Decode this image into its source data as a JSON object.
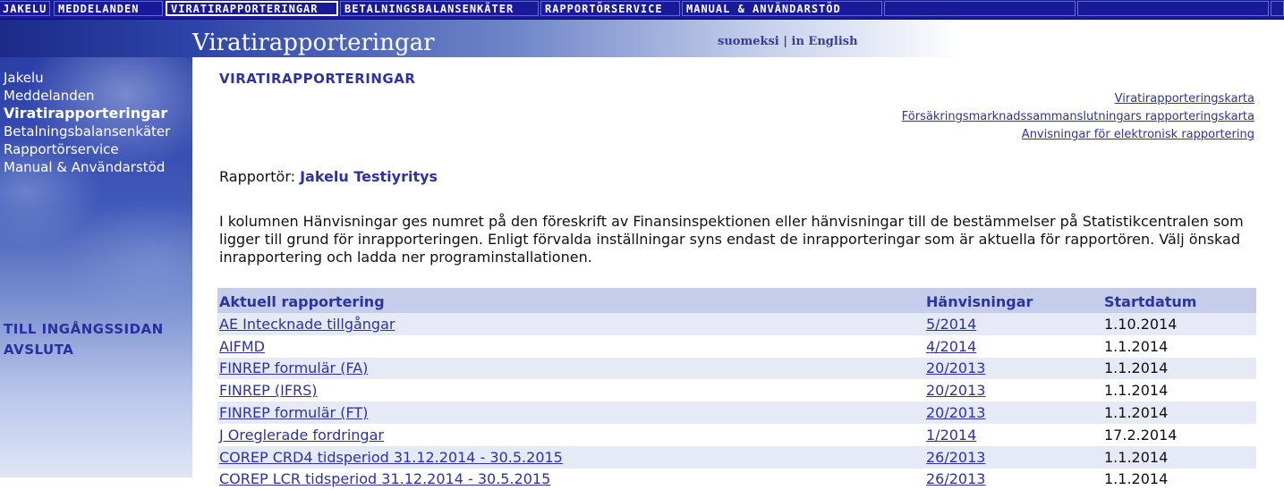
{
  "topnav": {
    "items": [
      "JAKELU",
      "MEDDELANDEN",
      "VIRATIRAPPORTERINGAR",
      "BETALNINGSBALANSENKÄTER",
      "RAPPORTÖRSERVICE",
      "MANUAL & ANVÄNDARSTÖD"
    ]
  },
  "header": {
    "title": "Viratirapporteringar",
    "lang_fi": "suomeksi",
    "lang_sep": " | ",
    "lang_en": "in English"
  },
  "sidebar": {
    "items": [
      "Jakelu",
      "Meddelanden",
      "Viratirapporteringar",
      "Betalningsbalansenkäter",
      "Rapportörservice",
      "Manual & Användarstöd"
    ],
    "bottom": [
      "TILL INGÅNGSSIDAN",
      "AVSLUTA"
    ]
  },
  "main": {
    "title": "VIRATIRAPPORTERINGAR",
    "links": [
      "Viratirapporteringskarta",
      "Försäkringsmarknadssammanslutningars rapporteringskarta",
      "Anvisningar för elektronisk rapportering"
    ],
    "reporter_label": "Rapportör:",
    "reporter_name": "Jakelu Testiyritys",
    "intro": "I kolumnen Hänvisningar ges numret på den föreskrift av Finansinspektionen eller hänvisningar till de bestämmelser på Statistikcentralen som ligger till grund för inrapporteringen. Enligt förvalda inställningar syns endast de inrapporteringar som är aktuella för rapportören. Välj önskad inrapportering och ladda ner programinstallationen.",
    "table": {
      "headers": [
        "Aktuell rapportering",
        "Hänvisningar",
        "Startdatum"
      ],
      "rows": [
        {
          "name": "AE Intecknade tillgångar",
          "ref": "5/2014",
          "date": "1.10.2014"
        },
        {
          "name": "AIFMD",
          "ref": "4/2014",
          "date": "1.1.2014"
        },
        {
          "name": "FINREP formulär (FA)",
          "ref": "20/2013",
          "date": "1.1.2014"
        },
        {
          "name": "FINREP (IFRS)",
          "ref": "20/2013",
          "date": "1.1.2014"
        },
        {
          "name": "FINREP formulär (FT)",
          "ref": "20/2013",
          "date": "1.1.2014"
        },
        {
          "name": "J Oreglerade fordringar",
          "ref": "1/2014",
          "date": "17.2.2014"
        },
        {
          "name": "COREP CRD4 tidsperiod 31.12.2014 - 30.5.2015",
          "ref": "26/2013",
          "date": "1.1.2014"
        },
        {
          "name": "COREP LCR tidsperiod 31.12.2014 - 30.5.2015",
          "ref": "26/2013",
          "date": "1.1.2014"
        }
      ]
    }
  }
}
